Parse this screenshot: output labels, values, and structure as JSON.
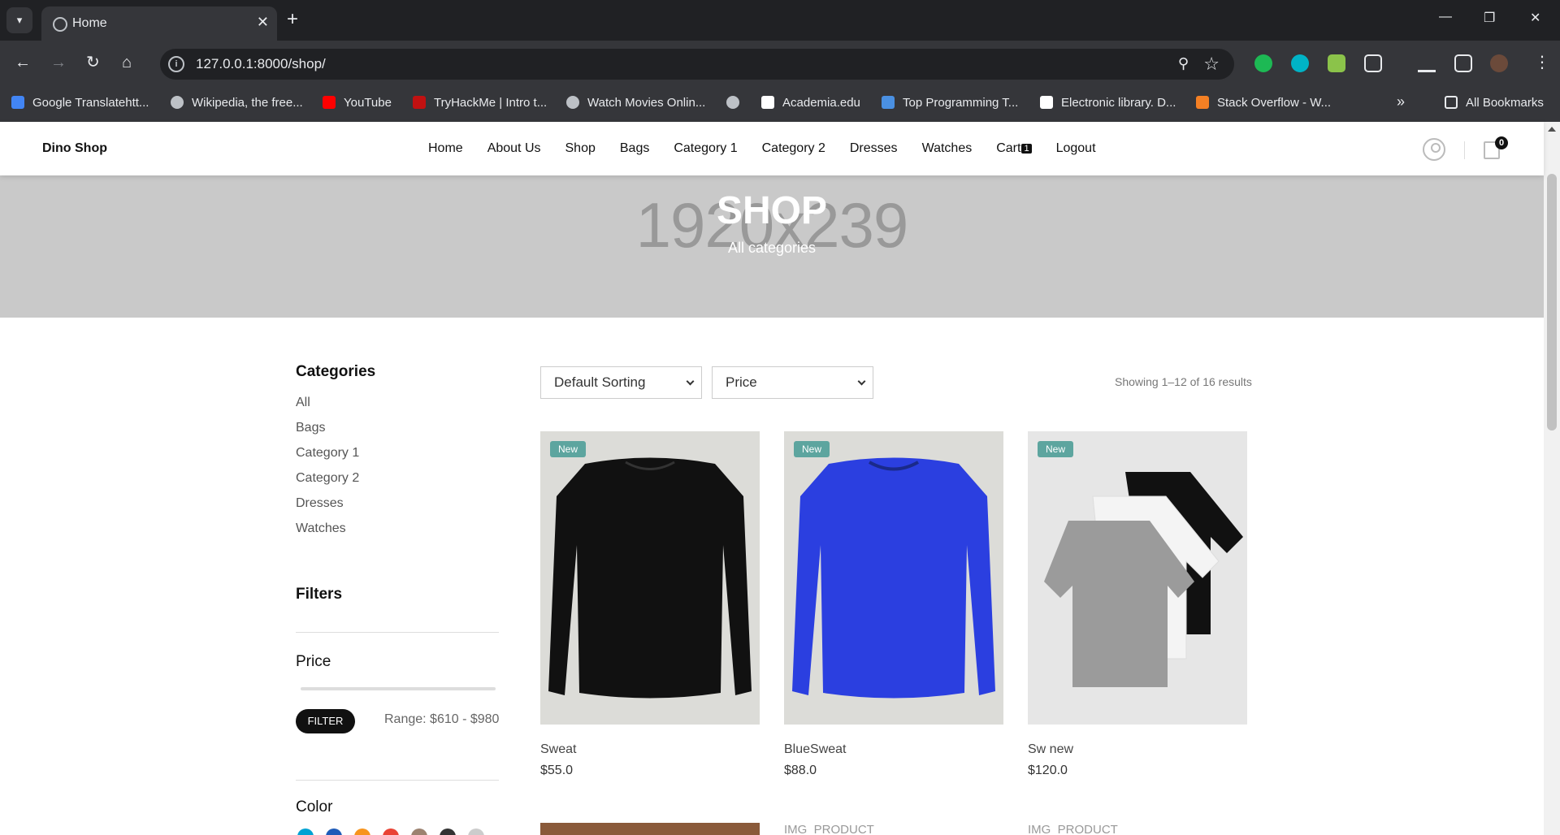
{
  "browser": {
    "tab_title": "Home",
    "url": "127.0.0.1:8000/shop/",
    "bookmarks": [
      {
        "label": "Google Translatehtt...",
        "color": "#4285f4"
      },
      {
        "label": "Wikipedia, the free...",
        "color": "#bdc1c6"
      },
      {
        "label": "YouTube",
        "color": "#ff0000"
      },
      {
        "label": "TryHackMe | Intro t...",
        "color": "#c11111"
      },
      {
        "label": "Watch Movies Onlin...",
        "color": "#bdc1c6"
      },
      {
        "label": "",
        "color": "#bdc1c6"
      },
      {
        "label": "Academia.edu",
        "color": "#ffffff"
      },
      {
        "label": "Top Programming T...",
        "color": "#4a90e2"
      },
      {
        "label": "Electronic library. D...",
        "color": "#ffffff"
      },
      {
        "label": "Stack Overflow - W...",
        "color": "#f48024"
      }
    ],
    "all_bookmarks": "All Bookmarks"
  },
  "header": {
    "logo": "Dino Shop",
    "nav": [
      "Home",
      "About Us",
      "Shop",
      "Bags",
      "Category 1",
      "Category 2",
      "Dresses",
      "Watches",
      "Cart",
      "Logout"
    ],
    "cart_badge": "1",
    "bag_count": "0"
  },
  "hero": {
    "placeholder": "1920x239",
    "title": "SHOP",
    "subtitle": "All categories"
  },
  "sidebar": {
    "categories_title": "Categories",
    "categories": [
      "All",
      "Bags",
      "Category 1",
      "Category 2",
      "Dresses",
      "Watches"
    ],
    "filters_title": "Filters",
    "price_title": "Price",
    "filter_button": "FILTER",
    "range": "Range: $610 - $980",
    "color_title": "Color",
    "colors": [
      "#00a2d3",
      "#1e5bb8",
      "#f7941d",
      "#e94335",
      "#9c8270",
      "#333333",
      "#cccccc"
    ]
  },
  "toolbar": {
    "sorting": "Default Sorting",
    "price": "Price",
    "results": "Showing 1–12 of 16 results"
  },
  "products": [
    {
      "badge": "New",
      "name": "Sweat",
      "price": "$55.0",
      "image": "black-sweatshirt"
    },
    {
      "badge": "New",
      "name": "BlueSweat",
      "price": "$88.0",
      "image": "blue-sweatshirt"
    },
    {
      "badge": "New",
      "name": "Sw new",
      "price": "$120.0",
      "image": "tshirts-stack"
    }
  ],
  "products_row2_alt": "IMG_PRODUCT",
  "accent": "#5da59f"
}
